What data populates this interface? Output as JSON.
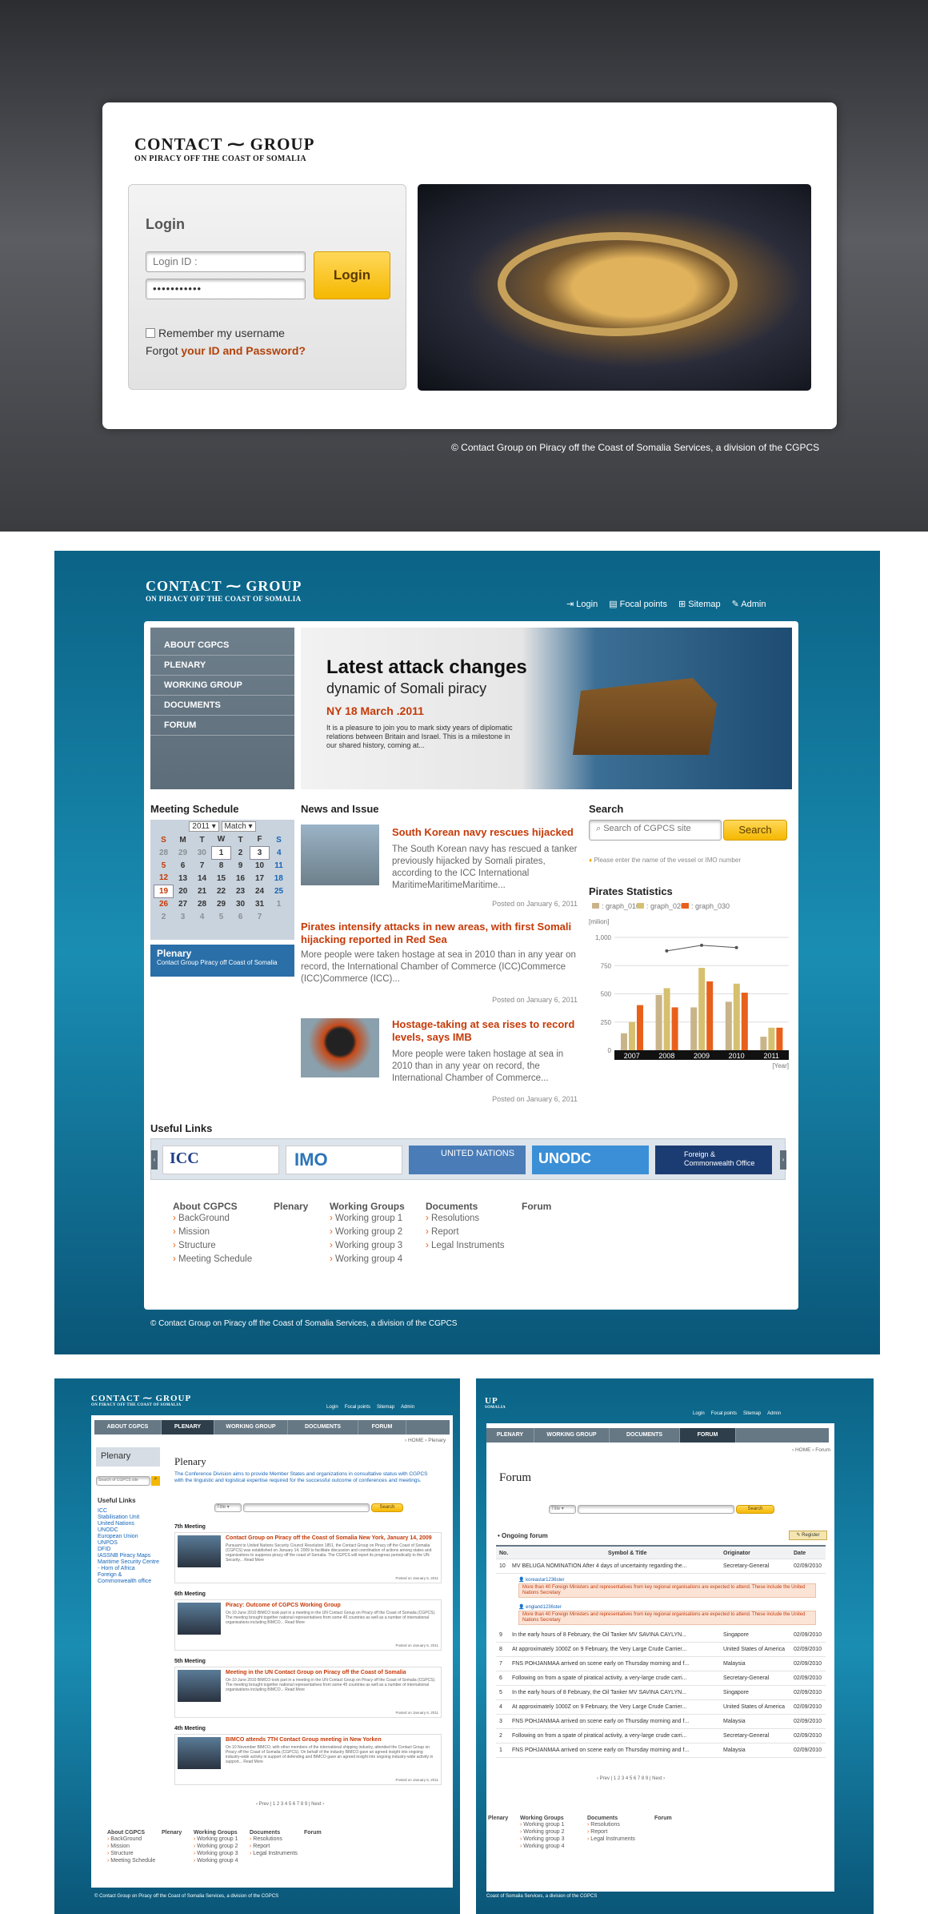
{
  "brand": {
    "logo_title": "CONTACT",
    "logo_title2": "GROUP",
    "logo_sub": "ON PIRACY OFF THE COAST OF SOMALIA"
  },
  "login_page": {
    "heading": "Login",
    "id_placeholder": "Login ID :",
    "password_mask": "•••••••••••",
    "login_button": "Login",
    "remember_label": "Remember my username",
    "forgot_prefix": "Forgot ",
    "forgot_link": "your ID and Password?",
    "copyright": "© Contact Group on Piracy off the Coast of Somalia Services, a division of the CGPCS"
  },
  "home": {
    "top_links": [
      "Login",
      "Focal points",
      "Sitemap",
      "Admin"
    ],
    "nav": [
      "ABOUT CGPCS",
      "PLENARY",
      "WORKING GROUP",
      "DOCUMENTS",
      "FORUM"
    ],
    "hero": {
      "title": "Latest attack changes",
      "subtitle": "dynamic of Somali piracy",
      "date": "NY 18 March .2011",
      "text": "It is a pleasure to join you to mark sixty years of diplomatic relations between Britain and Israel. This is a milestone in our shared history, coming at..."
    },
    "meeting": {
      "heading": "Meeting Schedule",
      "year": "2011",
      "month": "Match",
      "days": [
        "S",
        "M",
        "T",
        "W",
        "T",
        "F",
        "S"
      ],
      "weeks": [
        [
          "28",
          "29",
          "30",
          "1",
          "2",
          "3",
          "4"
        ],
        [
          "5",
          "6",
          "7",
          "8",
          "9",
          "10",
          "11"
        ],
        [
          "12",
          "13",
          "14",
          "15",
          "16",
          "17",
          "18"
        ],
        [
          "19",
          "20",
          "21",
          "22",
          "23",
          "24",
          "25"
        ],
        [
          "26",
          "27",
          "28",
          "29",
          "30",
          "31",
          "1"
        ],
        [
          "2",
          "3",
          "4",
          "5",
          "6",
          "7",
          ""
        ]
      ],
      "plenary_title": "Plenary",
      "plenary_sub": "Contact Group Piracy off Coast of Somalia"
    },
    "news": {
      "heading": "News and Issue",
      "items": [
        {
          "title": "South Korean navy rescues hijacked",
          "body": "The South Korean navy has rescued a tanker previously hijacked by Somali pirates, according to the ICC International MaritimeMaritimeMaritime...",
          "posted": "Posted on January 6, 2011"
        },
        {
          "title": "Pirates intensify attacks in new areas, with first Somali hijacking reported in Red Sea",
          "body": "More people were taken hostage at sea in 2010 than in any year on record, the International Chamber of Commerce (ICC)Commerce (ICC)Commerce (ICC)...",
          "posted": "Posted on January 6, 2011"
        },
        {
          "title": "Hostage-taking at sea rises to record levels, says IMB",
          "body": "More people were taken hostage at sea in 2010 than in any year on record, the International Chamber of Commerce...",
          "posted": "Posted on January 6, 2011"
        }
      ]
    },
    "search": {
      "heading": "Search",
      "placeholder": "Search of CGPCS site",
      "button": "Search",
      "hint": "Please enter the name of the vessel or IMO number"
    },
    "stats": {
      "heading": "Pirates Statistics",
      "unit": "[milion]",
      "year_label": "[Year]"
    },
    "useful": {
      "heading": "Useful Links",
      "logos": [
        "ICC",
        "IMO",
        "UNITED NATIONS",
        "UNODC",
        "Foreign & Commonwealth Office"
      ]
    },
    "footer_cols": [
      {
        "title": "About CGPCS",
        "items": [
          "BackGround",
          "Mission",
          "Structure",
          "Meeting Schedule"
        ]
      },
      {
        "title": "Plenary",
        "items": []
      },
      {
        "title": "Working Groups",
        "items": [
          "Working group 1",
          "Working group 2",
          "Working group 3",
          "Working group 4"
        ]
      },
      {
        "title": "Documents",
        "items": [
          "Resolutions",
          "Report",
          "Legal Instruments"
        ]
      },
      {
        "title": "Forum",
        "items": []
      }
    ],
    "copyright": "© Contact Group on Piracy off the Coast of Somalia Services, a division of the CGPCS"
  },
  "chart_data": {
    "type": "bar",
    "categories": [
      "2007",
      "2008",
      "2009",
      "2010",
      "2011"
    ],
    "series": [
      {
        "name": "graph_010",
        "values": [
          150,
          490,
          380,
          430,
          120
        ]
      },
      {
        "name": "graph_020",
        "values": [
          250,
          550,
          730,
          590,
          200
        ]
      },
      {
        "name": "graph_030",
        "values": [
          400,
          380,
          610,
          510,
          200
        ]
      }
    ],
    "line": [
      {
        "x": "2008",
        "y": 880
      },
      {
        "x": "2009",
        "y": 930
      },
      {
        "x": "2010",
        "y": 910
      }
    ],
    "yticks": [
      "1,000",
      "750",
      "500",
      "250",
      "0"
    ],
    "ylim": [
      0,
      1000
    ],
    "xlabel": "",
    "ylabel": "[milion]"
  },
  "plenary_page": {
    "top_links": [
      "Login",
      "Focal points",
      "Sitemap",
      "Admin"
    ],
    "nav": [
      "ABOUT CGPCS",
      "PLENARY",
      "WORKING GROUP",
      "DOCUMENTS",
      "FORUM"
    ],
    "breadcrumb": "› HOME › Plenary",
    "side_title": "Plenary",
    "search_placeholder": "Search of CGPCS site",
    "useful": "Useful Links",
    "links": [
      "ICC",
      "Stabilisation Unit",
      "United Nations",
      "UNODC",
      "European Union",
      "UNPOS",
      "DFID",
      "IASSNB Piracy Maps",
      "Maritime Security Centre - Horn of Africa",
      "Foreign & Commonwealth office"
    ],
    "title": "Plenary",
    "intro": "The Conference Division aims to provide Member States and organizations in consultative status with CGPCS with the linguistic and logistical expertise required for the successful outcome of conferences and meetings.",
    "select": "Title",
    "search": "Search",
    "meetings": [
      {
        "label": "7th Meeting",
        "title": "Contact Group on Piracy off the Coast of Somalia New York, January 14, 2009",
        "text": "Pursuant to United Nations Security Council Resolution 1851, the Contact Group on Piracy off the Coast of Somalia (CGPCS) was established on January 14, 2009 to facilitate discussion and coordination of actions among states and organizations to suppress piracy off the coast of Somalia. The CGPCS will report its progress periodically to the UN Security... Read More",
        "posted": "Posted on January 6, 2011"
      },
      {
        "label": "6th Meeting",
        "title": "Piracy: Outcome of CGPCS Working Group",
        "text": "On 10 June 2010 BIMCO took part in a meeting in the UN Contact Group on Piracy off the Coast of Somalia (CGPCS). The meeting brought together national representatives from some 45 countries as well as a number of international organisations including BIMCO... Read More",
        "posted": "Posted on January 6, 2011"
      },
      {
        "label": "5th Meeting",
        "title": "Meeting in the UN Contact Group on Piracy off the Coast of Somalia",
        "text": "On 10 June 2010 BIMCO took part in a meeting in the UN Contact Group on Piracy off the Coast of Somalia (CGPCS). The meeting brought together national representatives from some 45 countries as well as a number of international organisations including BIMCO... Read More",
        "posted": "Posted on January 6, 2011"
      },
      {
        "label": "4th Meeting",
        "title": "BIMCO attends 7TH Contact Group meeting in New Yorken",
        "text": "On 10 November BIMCO, with other members of the international shipping industry, attended the Contact Group on Piracy off the Coast of Somalia (CGPCS). On behalf of the industry BIMCO gave an agreed insight into ongoing industry-wide activity in support of defending and BIMCO gave an agreed insight into ongoing industry-wide activity in support... Read More",
        "posted": "Posted on January 6, 2011"
      }
    ],
    "pager": "‹ Prev | 1 2 3 4 5 6 7 8 9 | Next ›",
    "footer_cols": [
      {
        "title": "About CGPCS",
        "items": [
          "BackGround",
          "Mission",
          "Structure",
          "Meeting Schedule"
        ]
      },
      {
        "title": "Plenary",
        "items": []
      },
      {
        "title": "Working Groups",
        "items": [
          "Working group 1",
          "Working group 2",
          "Working group 3",
          "Working group 4"
        ]
      },
      {
        "title": "Documents",
        "items": [
          "Resolutions",
          "Report",
          "Legal Instruments"
        ]
      },
      {
        "title": "Forum",
        "items": []
      }
    ],
    "copyright": "© Contact Group on Piracy off the Coast of Somalia Services, a division of the CGPCS"
  },
  "forum_page": {
    "logo_fragment": "UP",
    "logo_sub_fragment": "SOMALIA",
    "top_links": [
      "Login",
      "Focal points",
      "Sitemap",
      "Admin"
    ],
    "nav": [
      "PLENARY",
      "WORKING GROUP",
      "DOCUMENTS",
      "FORUM"
    ],
    "breadcrumb": "› HOME › Forum",
    "title": "Forum",
    "select": "Title",
    "search": "Search",
    "ongoing": "Ongoing forum",
    "register": "Register",
    "columns": [
      "No.",
      "Symbol & Title",
      "Originator",
      "Date"
    ],
    "first_row": {
      "no": "10",
      "title": "MV BELUGA NOMINATION After 4 days of uncertainty regarding the...",
      "org": "Secretary-General",
      "date": "02/09/2010"
    },
    "replies": [
      {
        "user": "koreastar1236ster",
        "text": "More than 40 Foreign Ministers and representatives from key regional organisations are expected to attend. These include the United Nations Secretary"
      },
      {
        "user": "england1236ster",
        "text": "More than 40 Foreign Ministers and representatives from key regional organisations are expected to attend. These include the United Nations Secretary"
      }
    ],
    "rows": [
      {
        "no": "9",
        "title": "In the early hours of 8 February, the Oil Tanker MV SAVINA CAYLYN...",
        "org": "Singapore",
        "date": "02/09/2010"
      },
      {
        "no": "8",
        "title": "At approximately 1000Z on 9 February, the Very Large Crude Carrier...",
        "org": "United States of America",
        "date": "02/09/2010"
      },
      {
        "no": "7",
        "title": "FNS POHJANMAA arrived on scene early on Thursday morning and f...",
        "org": "Malaysia",
        "date": "02/09/2010"
      },
      {
        "no": "6",
        "title": "Following on from a spate of piratical activity, a very-large crude carri...",
        "org": "Secretary-General",
        "date": "02/09/2010"
      },
      {
        "no": "5",
        "title": "In the early hours of 8 February, the Oil Tanker MV SAVINA CAYLYN...",
        "org": "Singapore",
        "date": "02/09/2010"
      },
      {
        "no": "4",
        "title": "At approximately 1000Z on 9 February, the Very Large Crude Carrier...",
        "org": "United States of America",
        "date": "02/09/2010"
      },
      {
        "no": "3",
        "title": "FNS POHJANMAA arrived on scene early on Thursday morning and f...",
        "org": "Malaysia",
        "date": "02/09/2010"
      },
      {
        "no": "2",
        "title": "Following on from a spate of piratical activity, a very-large crude carri...",
        "org": "Secretary-General",
        "date": "02/09/2010"
      },
      {
        "no": "1",
        "title": "FNS POHJANMAA arrived on scene early on Thursday morning and f...",
        "org": "Malaysia",
        "date": "02/09/2010"
      }
    ],
    "pager": "‹ Prev | 1 2 3 4 5 6 7 8 9 | Next ›",
    "footer_cols": [
      {
        "title": "Plenary",
        "items": []
      },
      {
        "title": "Working Groups",
        "items": [
          "Working group 1",
          "Working group 2",
          "Working group 3",
          "Working group 4"
        ]
      },
      {
        "title": "Documents",
        "items": [
          "Resolutions",
          "Report",
          "Legal Instruments"
        ]
      },
      {
        "title": "Forum",
        "items": []
      }
    ],
    "copyright": "Coast of Somalia Services, a division of the CGPCS"
  }
}
